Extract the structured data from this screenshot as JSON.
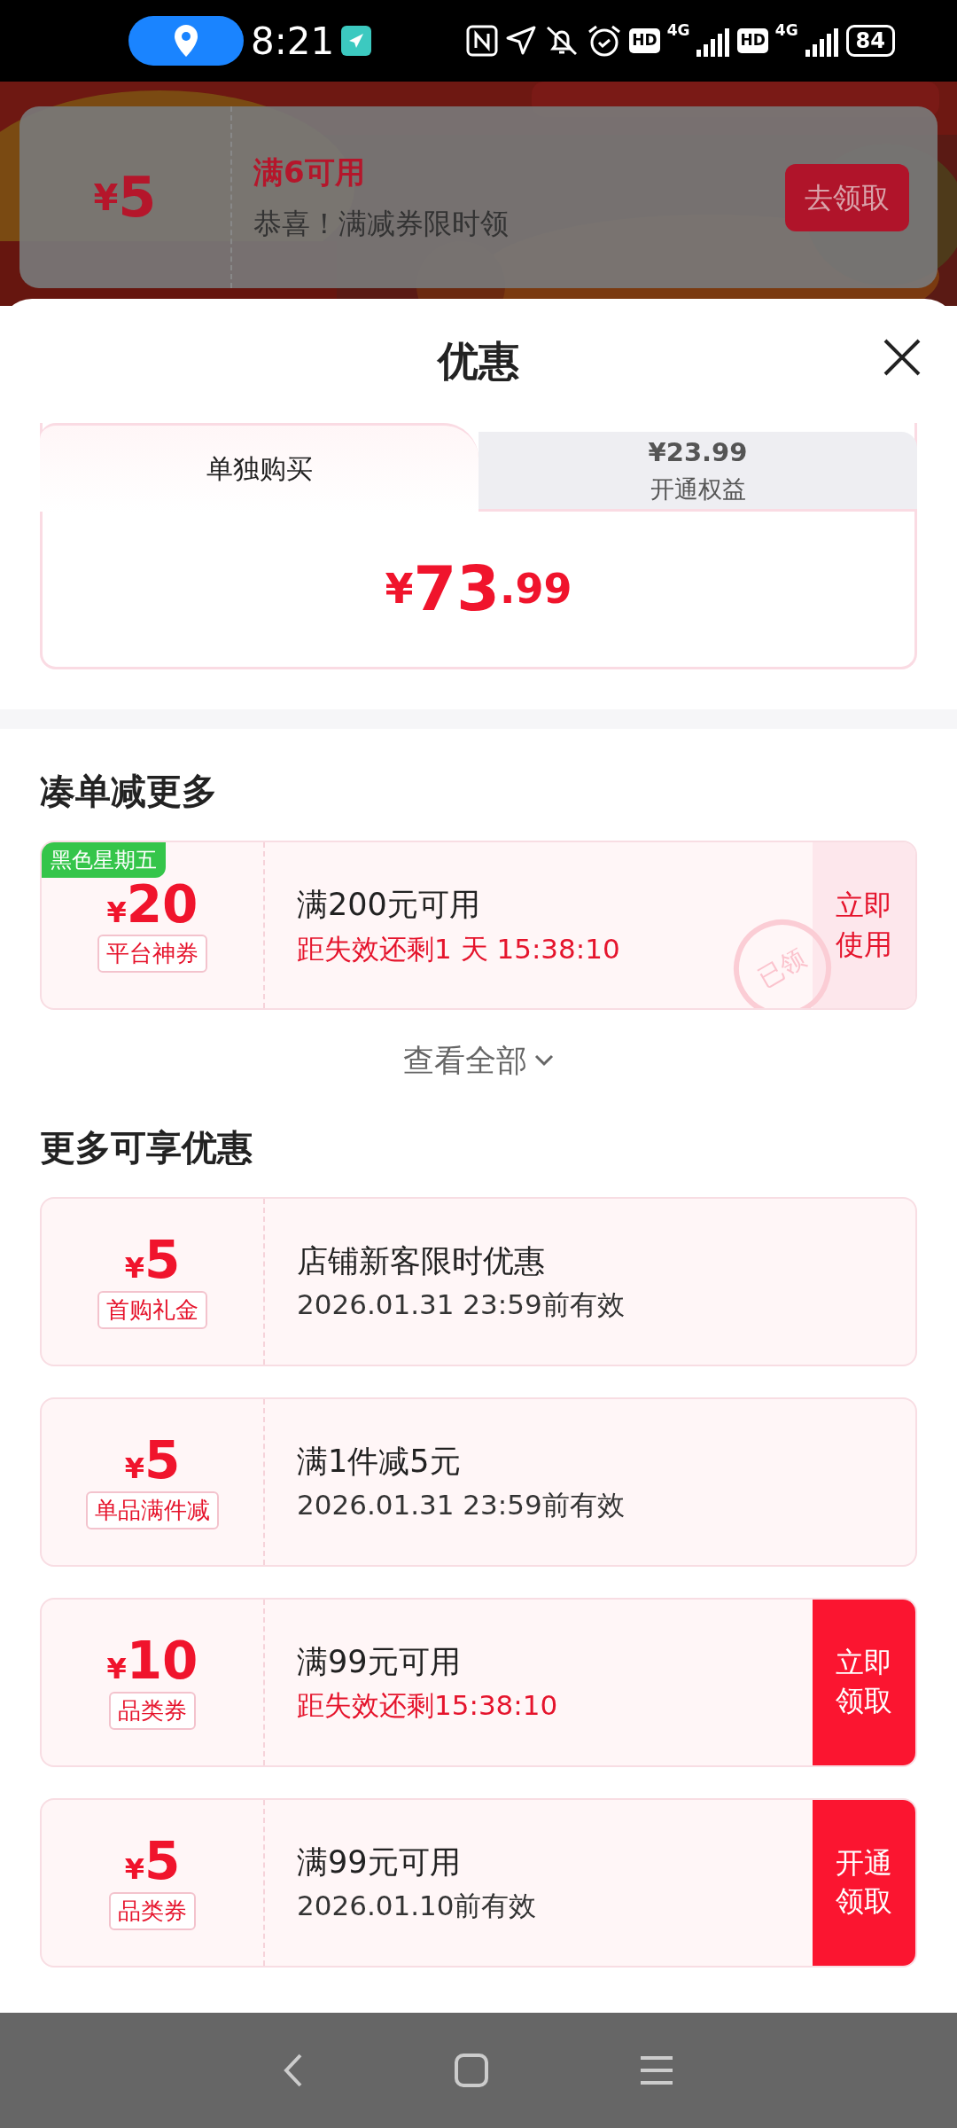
{
  "status_bar": {
    "time": "8:21",
    "hd_1": "HD",
    "network_1": "4G",
    "hd_2": "HD",
    "network_2": "4G",
    "battery": "84"
  },
  "promo_banner": {
    "symbol": "¥",
    "amount": "5",
    "condition": "满6可用",
    "message": "恭喜！满减券限时领",
    "button": "去领取"
  },
  "sheet": {
    "title": "优惠"
  },
  "purchase_tabs": [
    {
      "label": "单独购买",
      "selected": true
    },
    {
      "price": "¥23.99",
      "label": "开通权益",
      "selected": false
    }
  ],
  "price": {
    "symbol": "¥",
    "integer": "73",
    "decimal": ".99"
  },
  "sections": [
    {
      "title": "凑单减更多",
      "view_all": "查看全部",
      "coupons": [
        {
          "ribbon": "黑色星期五",
          "symbol": "¥",
          "amount": "20",
          "tag": "平台神券",
          "title": "满200元可用",
          "note": "距失效还剩1 天 15:38:10",
          "urgent": true,
          "stamp": "已领",
          "action": [
            "立即",
            "使用"
          ],
          "filled": false
        }
      ]
    },
    {
      "title": "更多可享优惠",
      "coupons": [
        {
          "symbol": "¥",
          "amount": "5",
          "tag": "首购礼金",
          "title": "店铺新客限时优惠",
          "note": "2026.01.31 23:59前有效",
          "urgent": false
        },
        {
          "symbol": "¥",
          "amount": "5",
          "tag": "单品满件减",
          "title": "满1件减5元",
          "note": "2026.01.31 23:59前有效",
          "urgent": false
        },
        {
          "symbol": "¥",
          "amount": "10",
          "tag": "品类券",
          "title": "满99元可用",
          "note": "距失效还剩15:38:10",
          "urgent": true,
          "action": [
            "立即",
            "领取"
          ],
          "filled": true
        },
        {
          "symbol": "¥",
          "amount": "5",
          "tag": "品类券",
          "title": "满99元可用",
          "note": "2026.01.10前有效",
          "urgent": false,
          "action": [
            "开通",
            "领取"
          ],
          "filled": true
        }
      ]
    }
  ]
}
